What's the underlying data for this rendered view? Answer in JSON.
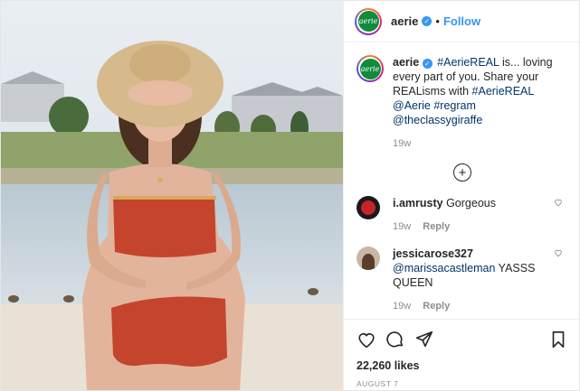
{
  "header": {
    "account": "aerie",
    "logo_text": "aerie",
    "separator": "•",
    "follow_label": "Follow"
  },
  "caption": {
    "user": "aerie",
    "text_parts": [
      "#AerieREAL",
      " is... loving every part of you. Share your REALisms with ",
      "#AerieREAL",
      " ",
      "@Aerie",
      " ",
      "#regram",
      " ",
      "@theclassygiraffe"
    ],
    "time": "19w"
  },
  "load_more_label": "+",
  "comments": [
    {
      "user": "i.amrusty",
      "text": "Gorgeous",
      "time": "19w",
      "reply": "Reply"
    },
    {
      "user": "jessicarose327",
      "mention": "@marissacastleman",
      "text": " YASSS QUEEN",
      "time": "19w",
      "reply": "Reply"
    }
  ],
  "likes_text": "22,260 likes",
  "date": "AUGUST 7",
  "icons": [
    "heart-icon",
    "comment-icon",
    "share-icon",
    "bookmark-icon",
    "verified-icon",
    "plus-circle-icon"
  ],
  "colors": {
    "accent": "#3897f0",
    "brand": "#118a3a",
    "swimsuit": "#c4442e"
  }
}
